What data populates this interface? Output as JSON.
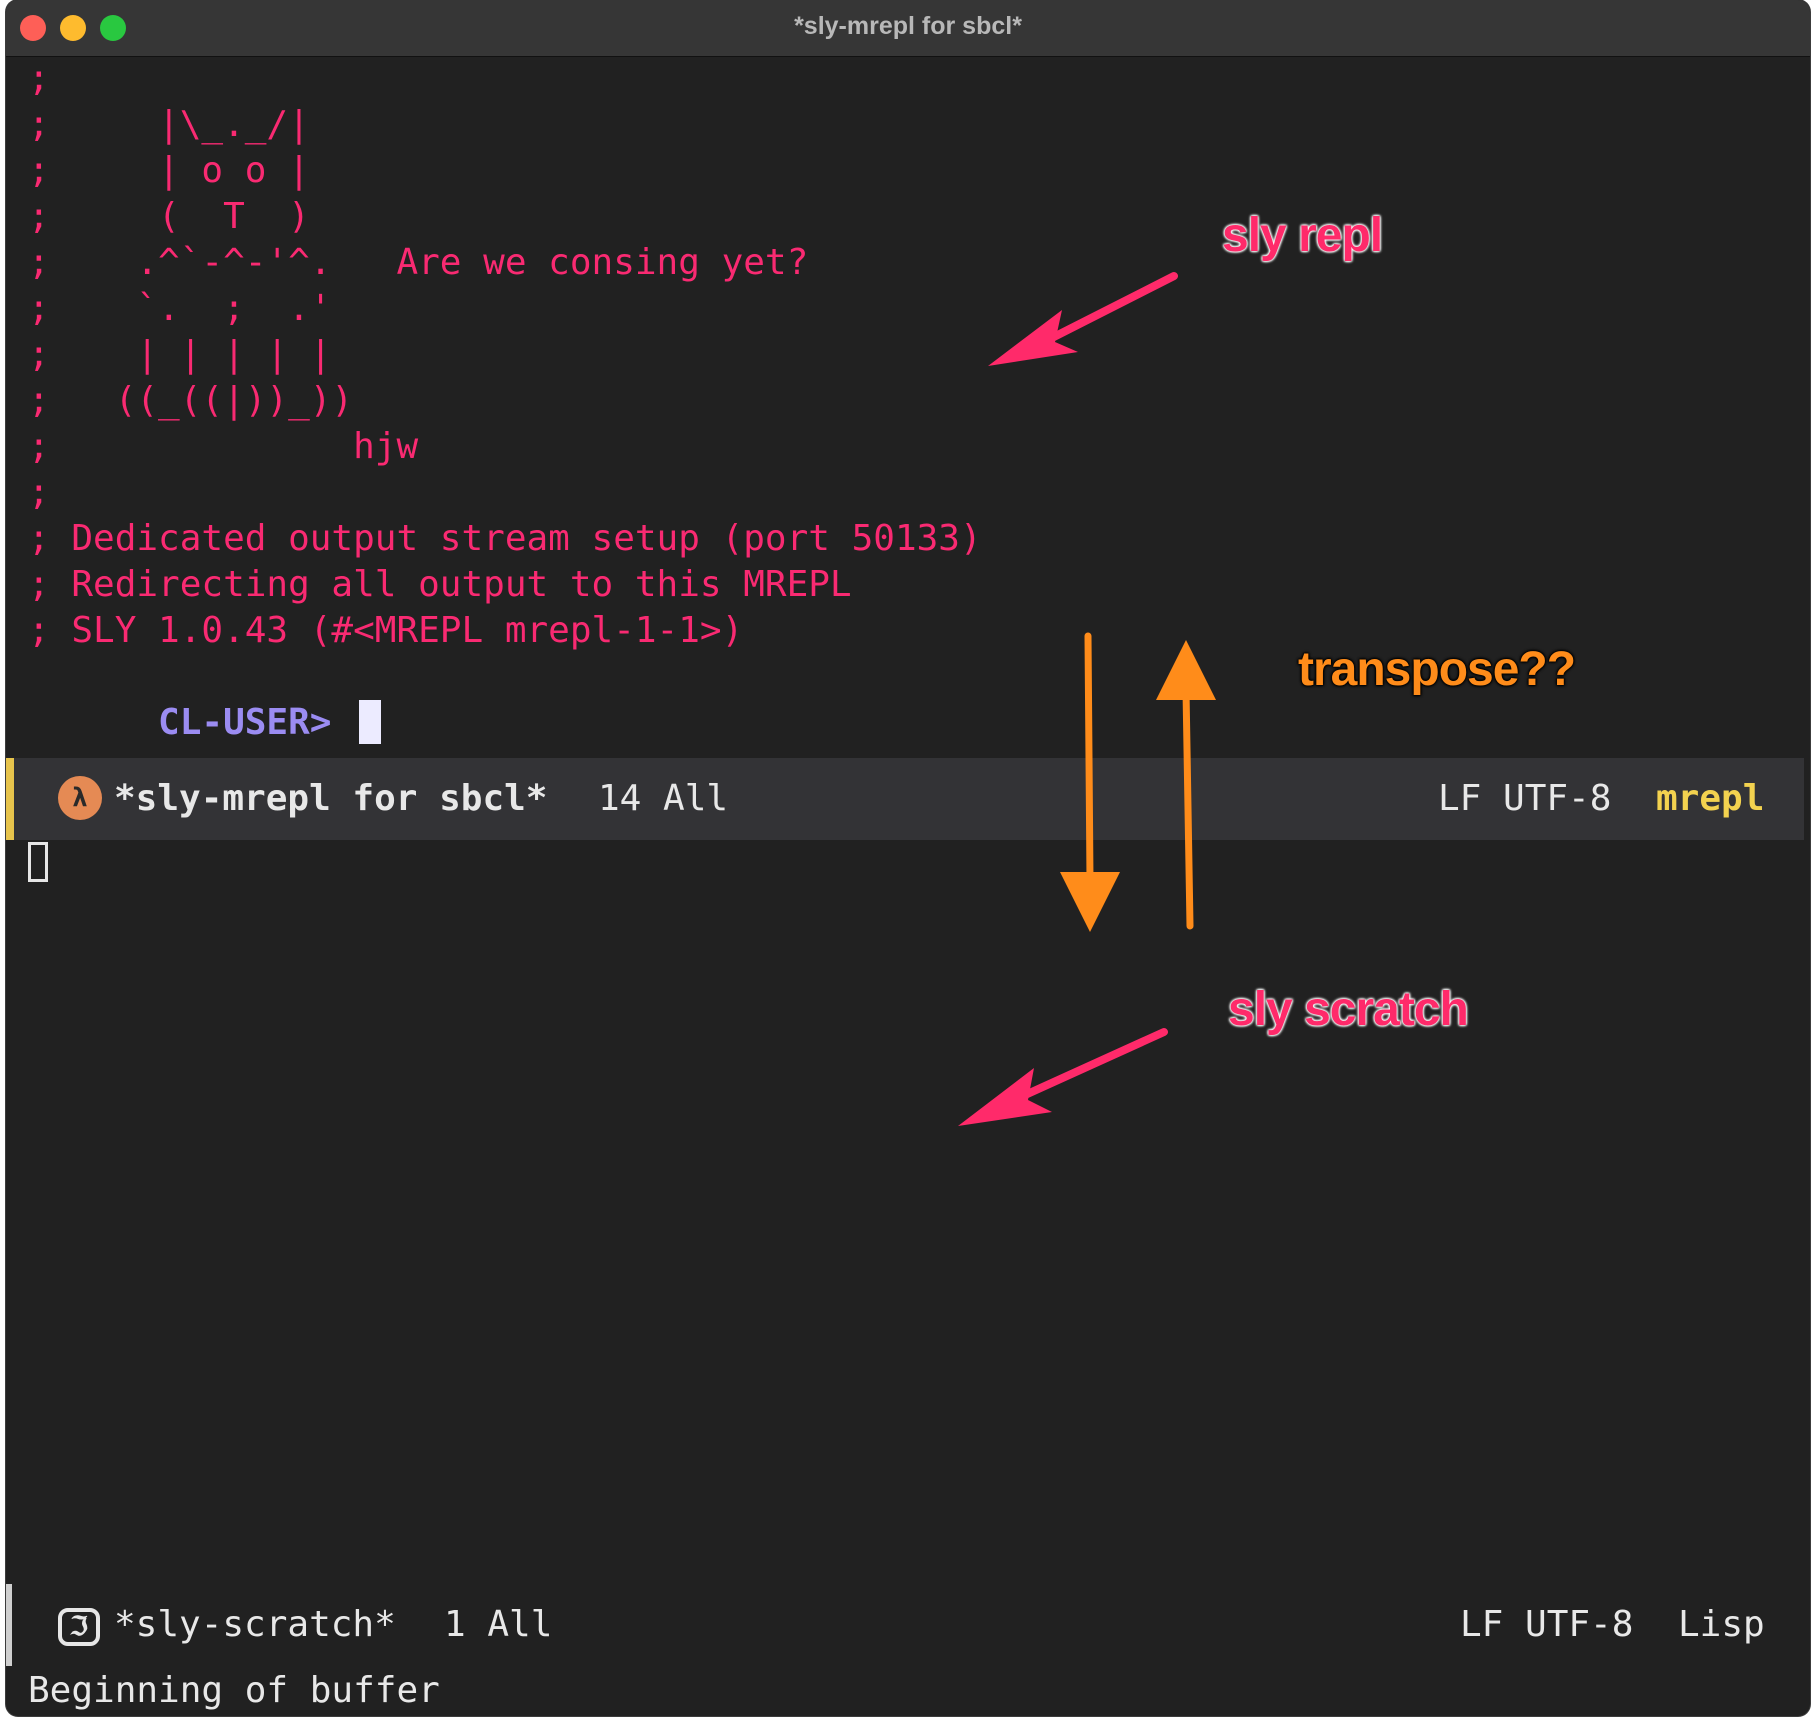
{
  "window": {
    "title": "*sly-mrepl for sbcl*"
  },
  "repl": {
    "lines": [
      ";",
      ";     |\\_._/|",
      ";     | o o |",
      ";     (  T  )",
      ";    .^`-^-'^.   Are we consing yet?",
      ";    `.  ;  .'",
      ";    | | | | |",
      ";   ((_((|))_))",
      ";              hjw",
      ";",
      "; Dedicated output stream setup (port 50133)",
      "; Redirecting all output to this MREPL",
      "; SLY 1.0.43 (#<MREPL mrepl-1-1>)"
    ],
    "prompt": "CL-USER> "
  },
  "modeline_repl": {
    "buffer_name": "*sly-mrepl for sbcl*",
    "position": "14 All",
    "encoding": "LF UTF-8",
    "mode": "mrepl",
    "icon": "sly-lambda-icon"
  },
  "modeline_scratch": {
    "buffer_name": "*sly-scratch*",
    "position": "1 All",
    "encoding": "LF UTF-8",
    "mode": "Lisp",
    "icon": "lisp-scratch-icon"
  },
  "echo_area": {
    "message": "Beginning of buffer"
  },
  "annotations": {
    "repl_label": "sly repl",
    "transpose_label": "transpose??",
    "scratch_label": "sly scratch"
  },
  "colors": {
    "background": "#212121",
    "repl_text": "#f92a72",
    "prompt": "#9b8cf2",
    "mode_highlight": "#f3d24f",
    "annotation_pink": "#ff2a6a",
    "annotation_orange": "#ff8c1a"
  }
}
